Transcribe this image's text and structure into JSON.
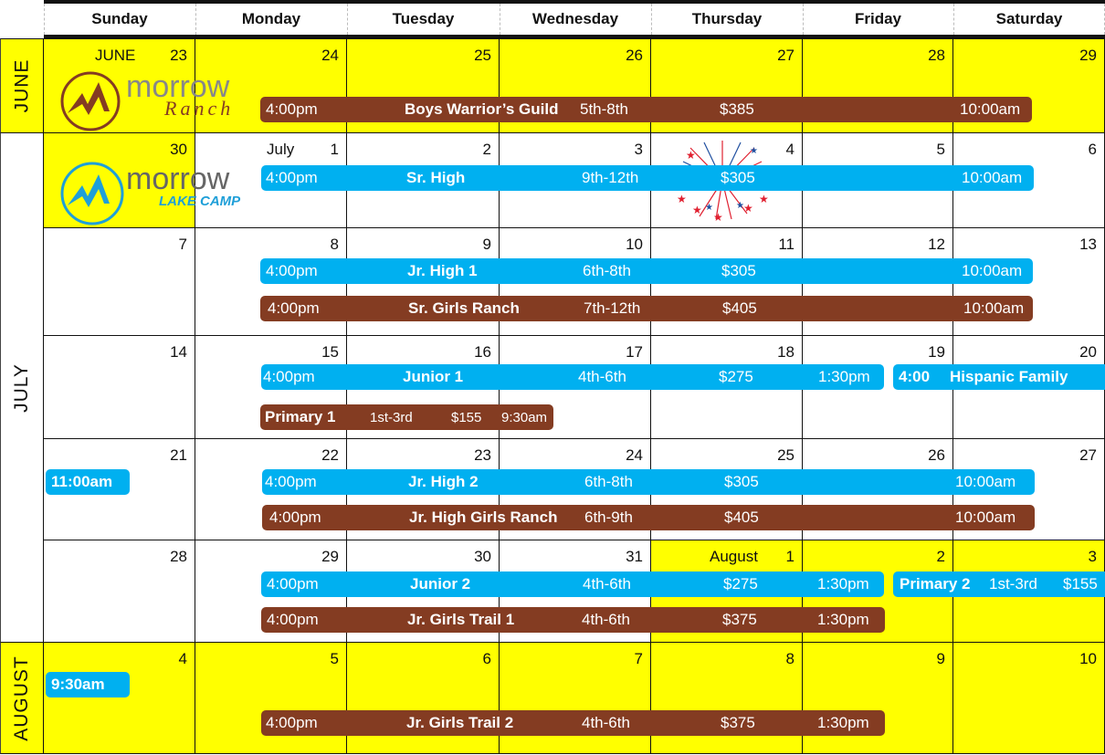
{
  "header": {
    "days": [
      "Sunday",
      "Monday",
      "Tuesday",
      "Wednesday",
      "Thursday",
      "Friday",
      "Saturday"
    ]
  },
  "months": {
    "june": "JUNE",
    "july": "JULY",
    "august": "AUGUST"
  },
  "cell_labels": {
    "june_label": "JUNE",
    "july_label": "July",
    "august_label": "August"
  },
  "weeks": [
    {
      "days": [
        "23",
        "24",
        "25",
        "26",
        "27",
        "28",
        "29"
      ]
    },
    {
      "days": [
        "30",
        "1",
        "2",
        "3",
        "4",
        "5",
        "6"
      ]
    },
    {
      "days": [
        "7",
        "8",
        "9",
        "10",
        "11",
        "12",
        "13"
      ]
    },
    {
      "days": [
        "14",
        "15",
        "16",
        "17",
        "18",
        "19",
        "20"
      ]
    },
    {
      "days": [
        "21",
        "22",
        "23",
        "24",
        "25",
        "26",
        "27"
      ]
    },
    {
      "days": [
        "28",
        "29",
        "30",
        "31",
        "1",
        "2",
        "3"
      ]
    },
    {
      "days": [
        "4",
        "5",
        "6",
        "7",
        "8",
        "9",
        "10"
      ]
    }
  ],
  "logos": {
    "ranch": {
      "word": "morrow",
      "sub": "Ranch",
      "color": "#843c22"
    },
    "lake": {
      "word": "morrow",
      "sub": "LAKE CAMP",
      "color": "#1f9fd8"
    }
  },
  "colors": {
    "highlight": "#ffff00",
    "lake_camp_blue": "#00b0f0",
    "ranch_brown": "#843c22"
  },
  "events": {
    "boys_warriors_guild": {
      "start": "4:00pm",
      "name": "Boys Warrior’s Guild",
      "grades": "5th-8th",
      "price": "$385",
      "end": "10:00am"
    },
    "sr_high": {
      "start": "4:00pm",
      "name": "Sr. High",
      "grades": "9th-12th",
      "price": "$305",
      "end": "10:00am"
    },
    "jr_high_1": {
      "start": "4:00pm",
      "name": "Jr. High 1",
      "grades": "6th-8th",
      "price": "$305",
      "end": "10:00am"
    },
    "sr_girls_ranch": {
      "start": "4:00pm",
      "name": "Sr. Girls Ranch",
      "grades": "7th-12th",
      "price": "$405",
      "end": "10:00am"
    },
    "junior_1": {
      "start": "4:00pm",
      "name": "Junior 1",
      "grades": "4th-6th",
      "price": "$275",
      "end": "1:30pm"
    },
    "hispanic_family": {
      "start": "4:00",
      "name": "Hispanic Family",
      "end": "11:00am"
    },
    "primary_1": {
      "name": "Primary 1",
      "grades": "1st-3rd",
      "price": "$155",
      "end": "9:30am"
    },
    "jr_high_2": {
      "start": "4:00pm",
      "name": "Jr. High 2",
      "grades": "6th-8th",
      "price": "$305",
      "end": "10:00am"
    },
    "jr_high_girls_ranch": {
      "start": "4:00pm",
      "name": "Jr. High Girls Ranch",
      "grades": "6th-9th",
      "price": "$405",
      "end": "10:00am"
    },
    "junior_2": {
      "start": "4:00pm",
      "name": "Junior 2",
      "grades": "4th-6th",
      "price": "$275",
      "end": "1:30pm"
    },
    "primary_2": {
      "name": "Primary 2",
      "grades": "1st-3rd",
      "price": "$155",
      "end": "9:30am"
    },
    "jr_girls_trail_1": {
      "start": "4:00pm",
      "name": "Jr. Girls Trail 1",
      "grades": "4th-6th",
      "price": "$375",
      "end": "1:30pm"
    },
    "jr_girls_trail_2": {
      "start": "4:00pm",
      "name": "Jr. Girls Trail 2",
      "grades": "4th-6th",
      "price": "$375",
      "end": "1:30pm"
    }
  }
}
